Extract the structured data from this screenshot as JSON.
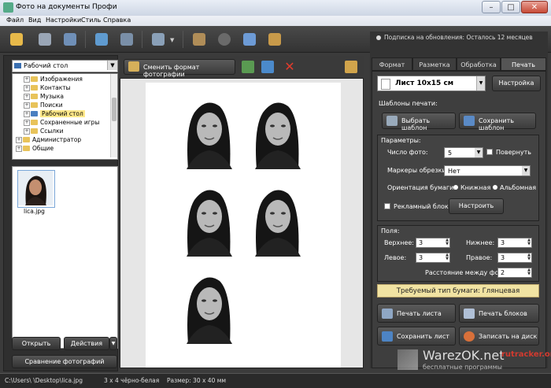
{
  "window": {
    "title": "Фото на документы Профи",
    "min": "–",
    "max": "□",
    "close": "✕"
  },
  "menu": [
    "Файл",
    "Вид",
    "Настройки",
    "Стиль",
    "Справка"
  ],
  "toolbar": {
    "icons": [
      "open-folder-icon",
      "save-icon",
      "print-icon",
      "user-photo-icon",
      "camera-icon",
      "monitor-icon",
      "help-book-icon",
      "film-icon",
      "box-icon",
      "product-icon"
    ],
    "colors": [
      "#e7b94a",
      "#9aa6b6",
      "#6f8fb7",
      "#5f9bd0",
      "#7a8fa8",
      "#8aa0b8",
      "#b08d58",
      "#6a6a6a",
      "#6d9bd6",
      "#c89a4a"
    ]
  },
  "subscription": {
    "label": "Подписка на обновления: Осталось 12 месяцев"
  },
  "left": {
    "folder_select": "Рабочий стол",
    "tree": [
      {
        "label": "Изображения",
        "indent": 2,
        "selected": false
      },
      {
        "label": "Контакты",
        "indent": 2,
        "selected": false
      },
      {
        "label": "Музыка",
        "indent": 2,
        "selected": false
      },
      {
        "label": "Поиски",
        "indent": 2,
        "selected": false
      },
      {
        "label": "Рабочий стол",
        "indent": 2,
        "selected": true
      },
      {
        "label": "Сохраненные игры",
        "indent": 2,
        "selected": false
      },
      {
        "label": "Ссылки",
        "indent": 2,
        "selected": false
      },
      {
        "label": "Администратор",
        "indent": 1,
        "selected": false
      },
      {
        "label": "Общие",
        "indent": 1,
        "selected": false
      }
    ],
    "thumb_label": "lica.jpg",
    "open_btn": "Открыть",
    "actions_btn": "Действия",
    "compare_btn": "Сравнение фотографий"
  },
  "center": {
    "change_format": "Сменить формат фотографии",
    "photo_count": 5
  },
  "tabs": [
    {
      "label": "Формат",
      "active": false
    },
    {
      "label": "Разметка",
      "active": false
    },
    {
      "label": "Обработка",
      "active": false
    },
    {
      "label": "Печать",
      "active": true
    }
  ],
  "print": {
    "sheet": "Лист 10x15 см",
    "settings_btn": "Настройка",
    "templates_head": "Шаблоны печати:",
    "choose_tpl": "Выбрать шаблон",
    "save_tpl": "Сохранить шаблон",
    "params_head": "Параметры:",
    "photo_count_lbl": "Число фото:",
    "photo_count_val": "5",
    "rotate_lbl": "Повернуть",
    "markers_lbl": "Маркеры обрезки:",
    "markers_val": "Нет",
    "orient_lbl": "Ориентация бумаги:",
    "orient_book": "Книжная",
    "orient_album": "Альбомная",
    "ad_lbl": "Рекламный блок:",
    "ad_btn": "Настроить",
    "margins_head": "Поля:",
    "top_lbl": "Верхнее:",
    "top_val": "3",
    "bottom_lbl": "Нижнее:",
    "bottom_val": "3",
    "left_lbl": "Левое:",
    "left_val": "3",
    "right_lbl": "Правое:",
    "right_val": "3",
    "gap_lbl": "Расстояние между фото:",
    "gap_val": "2",
    "paper_type": "Требуемый тип бумаги: Глянцевая",
    "print_sheet": "Печать листа",
    "print_blocks": "Печать блоков",
    "save_sheet": "Сохранить лист",
    "write_disk": "Записать на диск"
  },
  "status": {
    "path": "C:\\Users\\        \\Desktop\\lica.jpg",
    "mode": "3 x 4 чёрно-белая",
    "size": "Размер: 30 x 40 мм"
  },
  "watermark": {
    "site": "WarezOK.net",
    "tagline": "бесплатные программы",
    "logo": "rutracker.org"
  }
}
